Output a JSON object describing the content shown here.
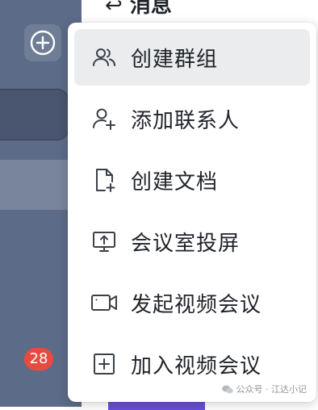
{
  "sidebar": {
    "unread_badge": "28"
  },
  "main": {
    "title_partial": "消息"
  },
  "menu": {
    "items": [
      {
        "label": "创建群组",
        "icon": "group-icon",
        "active": true
      },
      {
        "label": "添加联系人",
        "icon": "add-contact-icon",
        "active": false
      },
      {
        "label": "创建文档",
        "icon": "new-document-icon",
        "active": false
      },
      {
        "label": "会议室投屏",
        "icon": "screen-share-icon",
        "active": false
      },
      {
        "label": "发起视频会议",
        "icon": "video-camera-icon",
        "active": false
      },
      {
        "label": "加入视频会议",
        "icon": "join-meeting-icon",
        "active": false
      }
    ]
  },
  "watermark": {
    "text": "公众号 · 江达小记"
  },
  "colors": {
    "sidebar_bg": "#5c6b88",
    "badge_bg": "#e94a3f",
    "active_item_bg": "#ebecee",
    "text": "#1f2329"
  }
}
